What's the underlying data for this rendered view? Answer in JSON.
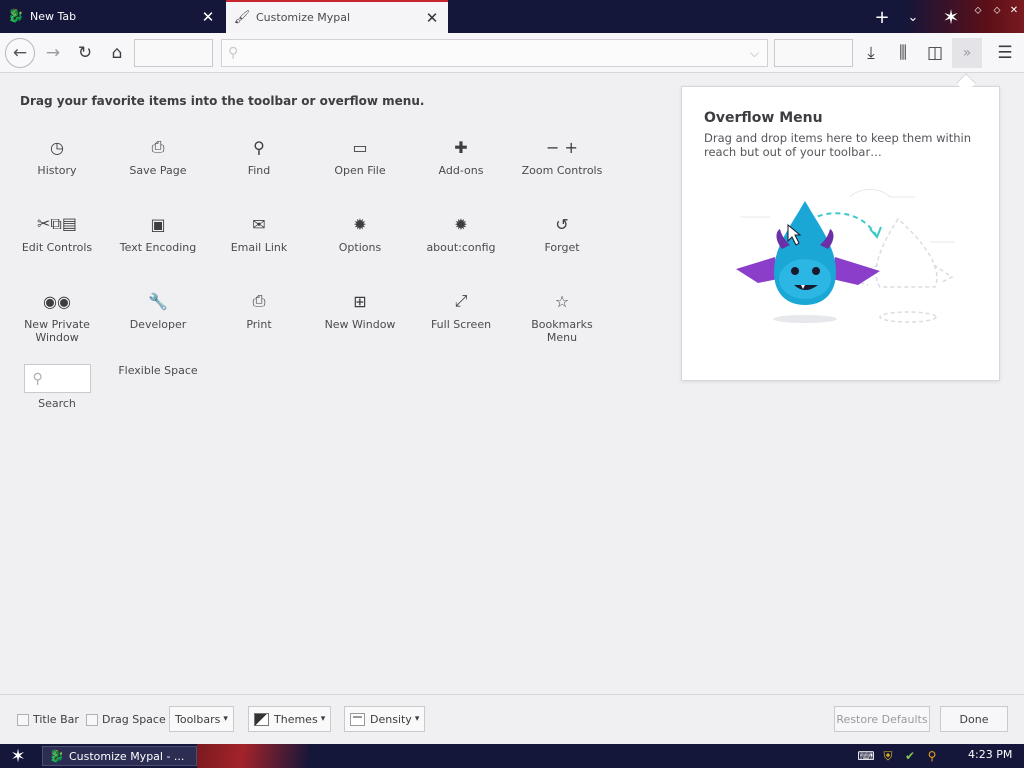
{
  "tabs": [
    {
      "label": "New Tab",
      "favicon": "dragon-favicon-icon",
      "close": "✕"
    },
    {
      "label": "Customize Mypal",
      "favicon": "paintbrush-icon",
      "close": "✕"
    }
  ],
  "tabstrip": {
    "new_tab_glyph": "+",
    "list_glyph": "⌄",
    "logo_glyph": "✶",
    "min_glyph": "⬦",
    "max_glyph": "⬦",
    "close_glyph": "✕"
  },
  "navbar": {
    "back_glyph": "←",
    "forward_glyph": "→",
    "reload_glyph": "↻",
    "home_glyph": "⌂",
    "url_value": "",
    "url_placeholder": "",
    "downloads_glyph": "⤓",
    "library_glyph": "⫼",
    "sidebar_glyph": "◫",
    "overflow_glyph": "»",
    "menu_glyph": "☰"
  },
  "palette": {
    "header": "Drag your favorite items into the toolbar or overflow menu.",
    "items": [
      {
        "name": "history",
        "label": "History",
        "icon": "clock-icon",
        "glyph": "◷"
      },
      {
        "name": "save-page",
        "label": "Save Page",
        "icon": "save-page-icon",
        "glyph": "⎙"
      },
      {
        "name": "find",
        "label": "Find",
        "icon": "search-icon",
        "glyph": "⚲"
      },
      {
        "name": "open-file",
        "label": "Open File",
        "icon": "folder-icon",
        "glyph": "▭"
      },
      {
        "name": "add-ons",
        "label": "Add-ons",
        "icon": "puzzle-icon",
        "glyph": "✚"
      },
      {
        "name": "zoom-controls",
        "label": "Zoom Controls",
        "icon": "zoom-icon",
        "glyph": "−  +"
      },
      {
        "name": "edit-controls",
        "label": "Edit Controls",
        "icon": "scissors-icon",
        "glyph": "✂⧉▤"
      },
      {
        "name": "text-encoding",
        "label": "Text Encoding",
        "icon": "text-encoding-icon",
        "glyph": "▣"
      },
      {
        "name": "email-link",
        "label": "Email Link",
        "icon": "envelope-icon",
        "glyph": "✉"
      },
      {
        "name": "options",
        "label": "Options",
        "icon": "gear-icon",
        "glyph": "✹"
      },
      {
        "name": "about-config",
        "label": "about:config",
        "icon": "gear-icon",
        "glyph": "✹"
      },
      {
        "name": "forget",
        "label": "Forget",
        "icon": "forget-icon",
        "glyph": "↺"
      },
      {
        "name": "new-private-window",
        "label": "New Private Window",
        "icon": "mask-icon",
        "glyph": "◉◉"
      },
      {
        "name": "developer",
        "label": "Developer",
        "icon": "wrench-icon",
        "glyph": "🔧"
      },
      {
        "name": "print",
        "label": "Print",
        "icon": "printer-icon",
        "glyph": "⎙"
      },
      {
        "name": "new-window",
        "label": "New Window",
        "icon": "new-window-icon",
        "glyph": "⊞"
      },
      {
        "name": "full-screen",
        "label": "Full Screen",
        "icon": "expand-icon",
        "glyph": "⤢"
      },
      {
        "name": "bookmarks-menu",
        "label": "Bookmarks Menu",
        "icon": "star-icon",
        "glyph": "☆"
      },
      {
        "name": "search",
        "label": "Search",
        "icon": "search-icon",
        "glyph": "⚲"
      },
      {
        "name": "flexible-space",
        "label": "Flexible Space",
        "icon": "",
        "glyph": ""
      }
    ]
  },
  "overflow": {
    "title": "Overflow Menu",
    "description": "Drag and drop items here to keep them within reach but out of your toolbar…"
  },
  "bottombar": {
    "title_bar": "Title Bar",
    "drag_space": "Drag Space",
    "toolbars": "Toolbars",
    "themes": "Themes",
    "density": "Density",
    "restore_defaults": "Restore Defaults",
    "done": "Done",
    "caret": "▾"
  },
  "taskbar": {
    "start_glyph": "✶",
    "task_label": "Customize Mypal - ...",
    "clock": "4:23 PM",
    "tray_icons": [
      "keyboard-icon",
      "shield-icon",
      "network-icon",
      "search-icon"
    ]
  },
  "colors": {
    "tabstrip_bg": "#14163a",
    "accent_red": "#c52630",
    "mascot_blue": "#1aa7d6",
    "mascot_purple": "#8a3ec9",
    "dash_teal": "#3cc8c8"
  }
}
